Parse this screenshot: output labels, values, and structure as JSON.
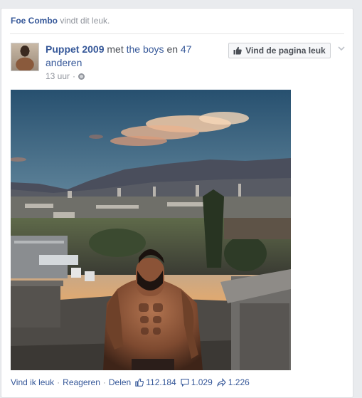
{
  "story": {
    "actor": "Foe Combo",
    "action": "vindt dit leuk."
  },
  "post": {
    "author": "Puppet 2009",
    "with_text": "met",
    "tagged": "the boys",
    "and_text": "en",
    "others": "47 anderen",
    "time": "13 uur",
    "separator": "·",
    "privacy_icon": "globe-icon"
  },
  "page_button": {
    "label": "Vind de pagina leuk",
    "icon": "thumbs-up-icon"
  },
  "actions": {
    "like": "Vind ik leuk",
    "comment": "Reageren",
    "share": "Delen",
    "dot": "·",
    "like_count": "112.184",
    "comment_count": "1.029",
    "share_count": "1.226"
  },
  "colors": {
    "link": "#365899",
    "meta": "#90949c",
    "text": "#4b4f56"
  }
}
